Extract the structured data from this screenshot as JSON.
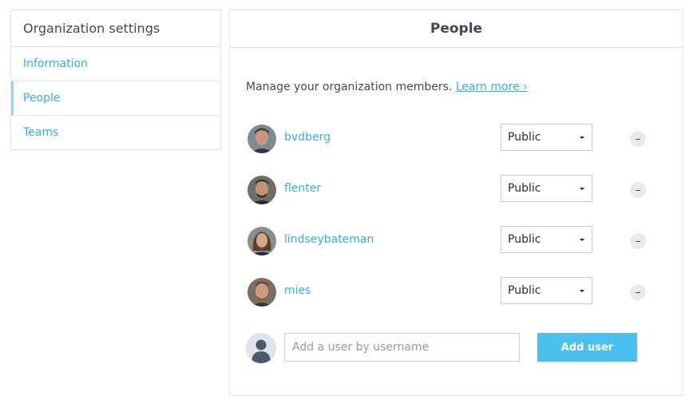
{
  "sidebar": {
    "title": "Organization settings",
    "items": [
      {
        "label": "Information",
        "active": false
      },
      {
        "label": "People",
        "active": true
      },
      {
        "label": "Teams",
        "active": false
      }
    ]
  },
  "panel": {
    "title": "People",
    "intro_text": "Manage your organization members.",
    "learn_more": "Learn more ›"
  },
  "members": [
    {
      "username": "bvdberg",
      "visibility": "Public",
      "avatar_colors": {
        "bg": "#7d8a94",
        "skin": "#c9987c",
        "hair": "#4a3a30"
      }
    },
    {
      "username": "flenter",
      "visibility": "Public",
      "avatar_colors": {
        "bg": "#6b6f66",
        "skin": "#c59278",
        "hair": "#2d2a26"
      }
    },
    {
      "username": "lindseybateman",
      "visibility": "Public",
      "avatar_colors": {
        "bg": "#8a8f88",
        "skin": "#d4a889",
        "hair": "#5a3e2a"
      }
    },
    {
      "username": "mies",
      "visibility": "Public",
      "avatar_colors": {
        "bg": "#7c6e64",
        "skin": "#cf9a7e",
        "hair": "#6b4a34"
      }
    }
  ],
  "add_user": {
    "placeholder": "Add a user by username",
    "button_label": "Add user"
  },
  "colors": {
    "link": "#36aee1",
    "accent_button": "#4bbfed",
    "border": "#e3e3e3"
  }
}
